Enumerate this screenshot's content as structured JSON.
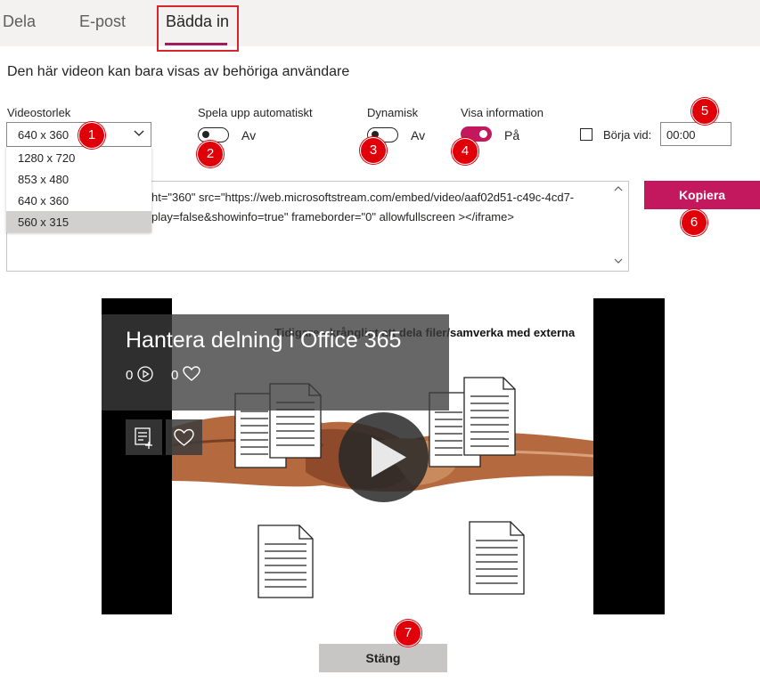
{
  "tabs": [
    {
      "label": "Dela"
    },
    {
      "label": "E-post"
    },
    {
      "label": "Bädda in"
    }
  ],
  "info_text": "Den här videon kan bara visas av behöriga användare",
  "video_size": {
    "label": "Videostorlek",
    "value": "640 x 360",
    "options": [
      "1280 x 720",
      "853 x 480",
      "640 x 360",
      "560 x 315"
    ],
    "highlighted_option": "560 x 315"
  },
  "autoplay": {
    "label": "Spela upp automatiskt",
    "state_label": "Av",
    "on": false
  },
  "dynamic": {
    "label": "Dynamisk",
    "state_label": "Av",
    "on": false
  },
  "show_info": {
    "label": "Visa information",
    "state_label": "På",
    "on": true
  },
  "start_at": {
    "label": "Börja vid:",
    "value": "00:00",
    "checked": false
  },
  "embed_code": {
    "line1": "ht=\"360\" src=\"https://web.microsoftstream.com/embed/video/aaf02d51-c49c-4cd7-",
    "line2": "play=false&showinfo=true\" frameborder=\"0\" allowfullscreen ></iframe>"
  },
  "copy_button": "Kopiera",
  "video": {
    "title": "Hantera delning i Office 365",
    "views": "0",
    "likes": "0",
    "slide_title": "Tidigare - krångligt att dela filer/samverka med externa"
  },
  "close_button": "Stäng",
  "badges": [
    "1",
    "2",
    "3",
    "4",
    "5",
    "6",
    "7"
  ],
  "colors": {
    "accent": "#c3185e",
    "badge": "#e0000a",
    "highlight_box": "#d6262b"
  }
}
